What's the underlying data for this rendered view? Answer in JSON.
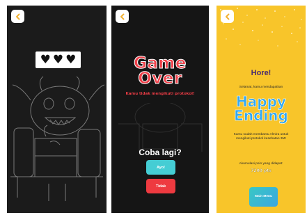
{
  "screen1": {
    "hearts": [
      "♥",
      "♥",
      "♥"
    ]
  },
  "screen2": {
    "title": "Game Over",
    "subtitle": "Kamu tidak mengikuti protokol!",
    "question": "Coba lagi?",
    "yes_label": "Ayo!",
    "no_label": "Tidak"
  },
  "screen3": {
    "title": "Hore!",
    "congrats": "Selamat, kamu mendapatkan",
    "ending": "Happy Ending",
    "message": "Kamu sudah membantu Almira untuk mengikuti protokol kesehatan 3M!",
    "points_label": "Akumulasi poin yang didapat:",
    "points_value": "7200 pts",
    "menu_label": "Main Menu"
  },
  "colors": {
    "dark_bg": "#1b1b1b",
    "game_over_red": "#f0424b",
    "yes_button": "#45cdd4",
    "no_button": "#ee3a40",
    "happy_bg": "#f8c52a",
    "happy_blue": "#33a8ef",
    "back_button": "#ffffff",
    "back_chevron": "#f2b233"
  }
}
